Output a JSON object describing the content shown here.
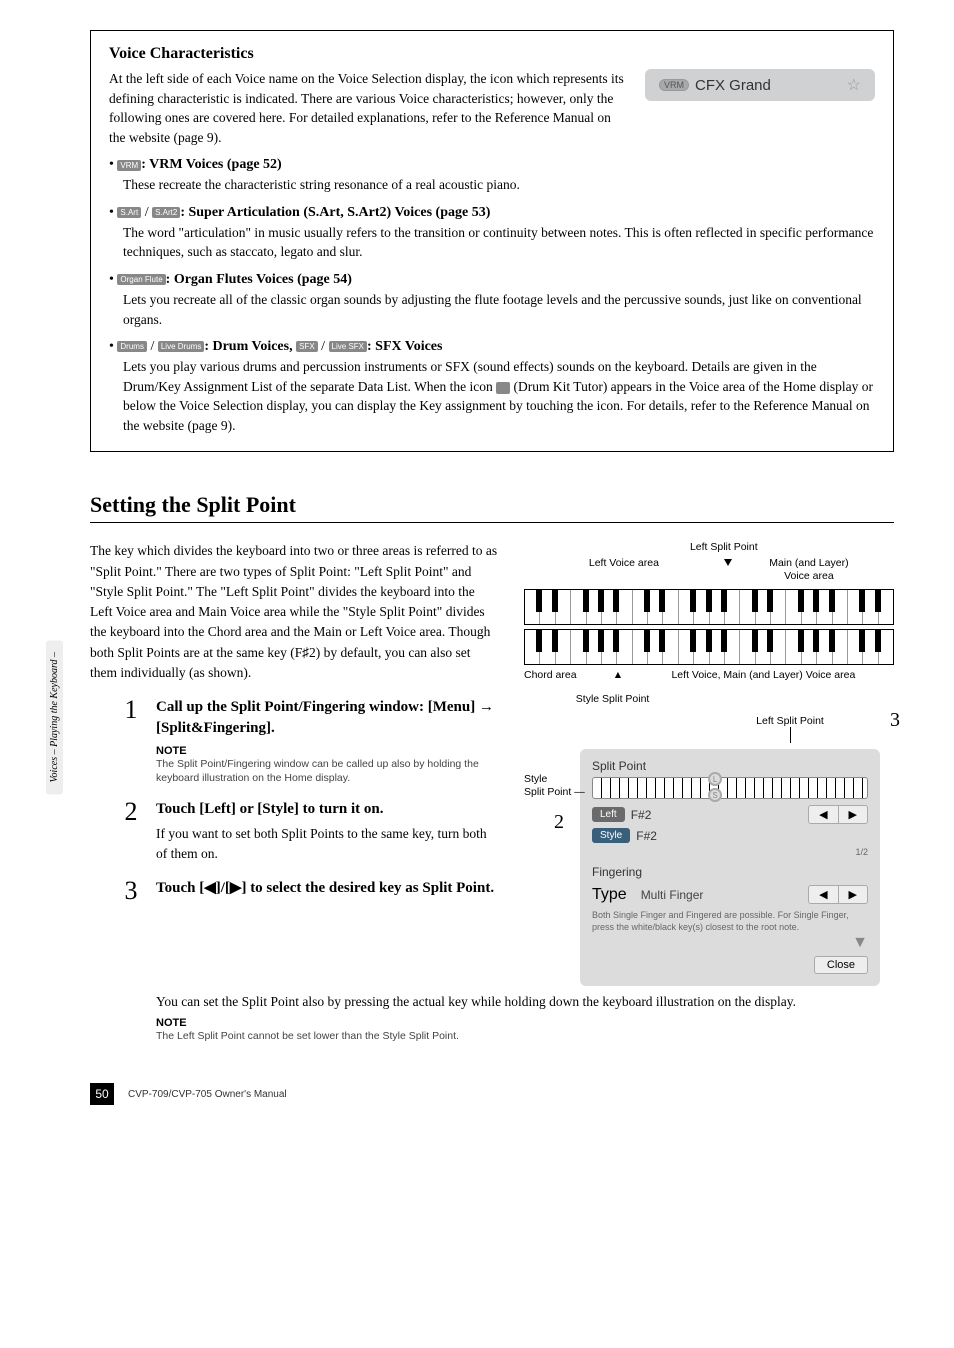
{
  "box": {
    "heading": "Voice Characteristics",
    "intro": "At the left side of each Voice name on the Voice Selection display, the icon which represents its defining characteristic is indicated. There are various Voice characteristics; however, only the following ones are covered here. For detailed explanations, refer to the Reference Manual on the website (page 9).",
    "badge_icon": "VRM",
    "badge_text": "CFX Grand",
    "bullets": [
      {
        "icons": [
          "VRM"
        ],
        "head": ": VRM Voices (page 52)",
        "desc": "These recreate the characteristic string resonance of a real acoustic piano."
      },
      {
        "icons": [
          "S.Art",
          "S.Art2"
        ],
        "joiner": " / ",
        "head": ": Super Articulation (S.Art, S.Art2) Voices (page 53)",
        "desc": "The word \"articulation\" in music usually refers to the transition or continuity between notes. This is often reflected in specific performance techniques, such as staccato, legato and slur."
      },
      {
        "icons": [
          "Organ Flute"
        ],
        "head": ": Organ Flutes Voices (page 54)",
        "desc": "Lets you recreate all of the classic organ sounds by adjusting the flute footage levels and the percussive sounds, just like on conventional organs."
      },
      {
        "icons": [
          "Drums",
          "Live Drums"
        ],
        "joiner": " / ",
        "head": ": Drum Voices, ",
        "icons2": [
          "SFX",
          "Live SFX"
        ],
        "joiner2": " / ",
        "head2": ": SFX Voices",
        "desc_parts": {
          "a": "Lets you play various drums and percussion instruments or SFX (sound effects) sounds on the keyboard. Details are given in the Drum/Key Assignment List of the separate Data List. When the icon ",
          "b": " (Drum Kit Tutor) appears in the Voice area of the Home display or below the Voice Selection display, you can display the Key assignment by touching the icon. For details, refer to the Reference Manual on the website (page 9)."
        }
      }
    ]
  },
  "h2": "Setting the Split Point",
  "body_para": "The key which divides the keyboard into two or three areas is referred to as \"Split Point.\" There are two types of Split Point: \"Left Split Point\" and \"Style Split Point.\" The \"Left Split Point\" divides the keyboard into the Left Voice area and Main Voice area while the \"Style Split Point\" divides the keyboard into the Chord area and the Main or Left Voice area. Though both Split Points are at the same key (F♯2) by default, you can also set them individually (as shown).",
  "steps": [
    {
      "num": "1",
      "title": "Call up the Split Point/Fingering window: [Menu] → [Split&Fingering].",
      "note_label": "NOTE",
      "note": "The Split Point/Fingering window can be called up also by holding the keyboard illustration on the Home display."
    },
    {
      "num": "2",
      "title": "Touch [Left] or [Style] to turn it on.",
      "text": "If you want to set both Split Points to the same key, turn both of them on."
    },
    {
      "num": "3",
      "title": "Touch [◀]/[▶] to select the desired key as Split Point.",
      "text": "You can set the Split Point also by pressing the actual key while holding down the keyboard illustration on the display.",
      "note_label": "NOTE",
      "note": "The Left Split Point cannot be set lower than the Style Split Point."
    }
  ],
  "dia": {
    "left_sp": "Left Split Point",
    "left_voice": "Left Voice area",
    "main_voice_l1": "Main (and Layer)",
    "main_voice_l2": "Voice area",
    "chord": "Chord area",
    "lv_main": "Left Voice, Main (and Layer) Voice area",
    "style_sp": "Style Split Point"
  },
  "sp": {
    "lsp": "Left Split Point",
    "style_l1": "Style",
    "style_l2": "Split Point",
    "panel_title": "Split Point",
    "left_btn": "Left",
    "style_btn": "Style",
    "val": "F#2",
    "page": "1/2",
    "fing": "Fingering",
    "type_lbl": "Type",
    "type_val": "Multi Finger",
    "desc": "Both Single Finger and Fingered are possible. For Single Finger, press the white/black key(s) closest to the root note.",
    "close": "Close",
    "callout2": "2",
    "callout3": "3"
  },
  "side": "Voices – Playing the Keyboard –",
  "footer": {
    "page": "50",
    "ref": "CVP-709/CVP-705 Owner's Manual"
  }
}
